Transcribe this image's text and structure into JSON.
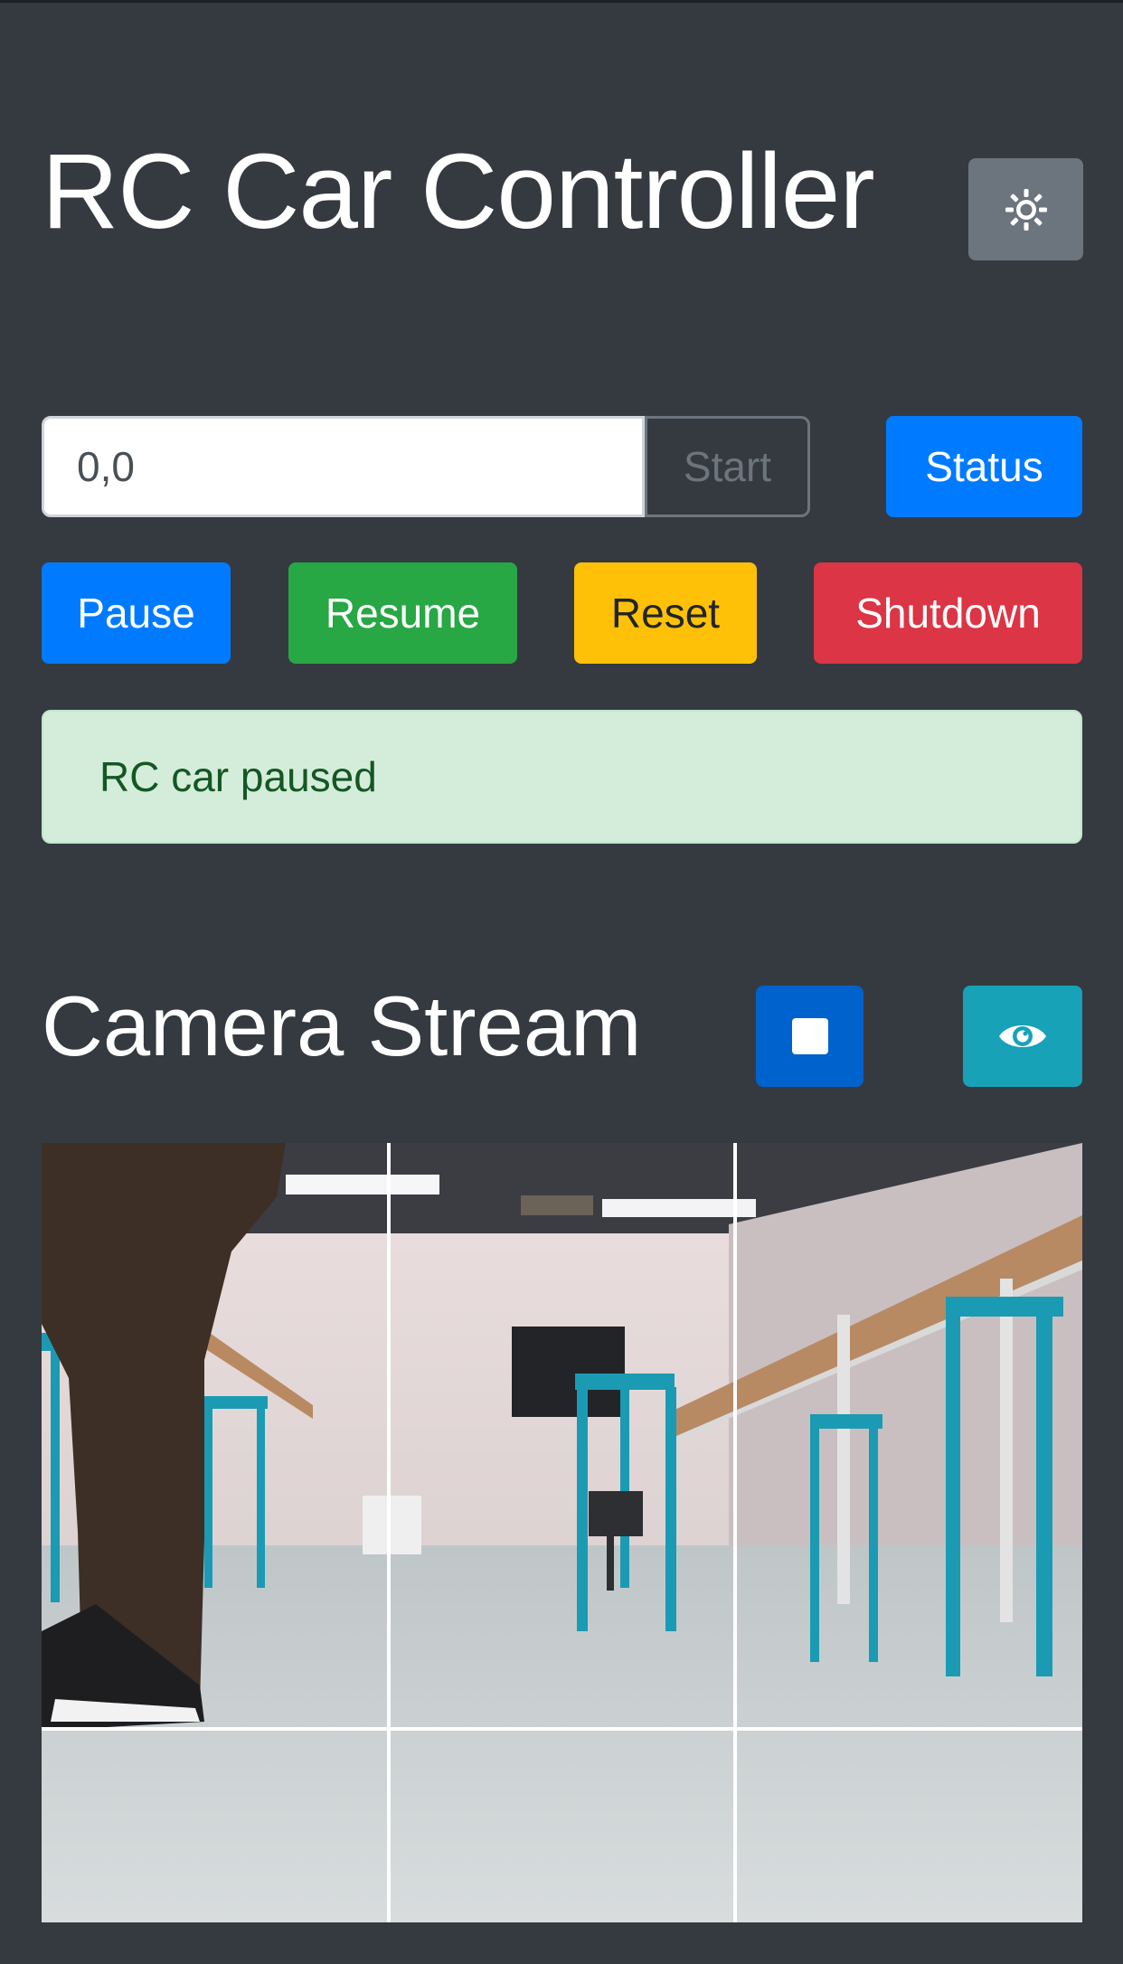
{
  "header": {
    "title": "RC Car Controller",
    "theme_toggle_icon": "sun-icon"
  },
  "controls": {
    "coordinate_input": {
      "value": "0,0",
      "placeholder": ""
    },
    "start_label": "Start",
    "status_label": "Status",
    "pause_label": "Pause",
    "resume_label": "Resume",
    "reset_label": "Reset",
    "shutdown_label": "Shutdown"
  },
  "alert": {
    "message": "RC car paused",
    "type": "success"
  },
  "camera": {
    "title": "Camera Stream",
    "stop_icon": "stop-icon",
    "view_icon": "eye-icon",
    "overlay": "grid-lines"
  },
  "colors": {
    "background": "#343a40",
    "primary": "#007bff",
    "success": "#28a745",
    "warning": "#ffc107",
    "danger": "#dc3545",
    "secondary": "#6c757d",
    "info": "#17a2b8",
    "alert_bg": "#d4edda",
    "alert_text": "#155724"
  }
}
